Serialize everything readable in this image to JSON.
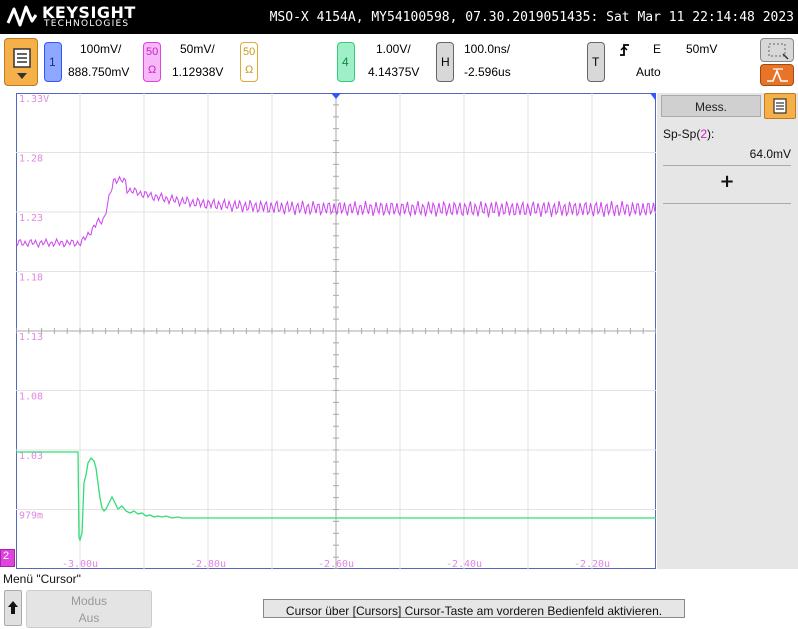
{
  "header": {
    "brand": "KEYSIGHT",
    "brand_sub": "TECHNOLOGIES",
    "instrument": "MSO-X 4154A, MY54100598, 07.30.2019051435: Sat Mar 11 22:14:48 2023"
  },
  "toolbar": {
    "ch1": {
      "num": "1",
      "scale": "100mV/",
      "offset": "888.750mV"
    },
    "ch2": {
      "imp_top": "50",
      "imp_bot": "Ω",
      "scale": "50mV/",
      "offset": "1.12938V"
    },
    "ch3": {
      "imp_top": "50",
      "imp_bot": "Ω"
    },
    "ch4": {
      "num": "4",
      "scale": "1.00V/",
      "offset": "4.14375V"
    },
    "horiz": {
      "label": "H",
      "scale": "100.0ns/",
      "offset": "-2.596us"
    },
    "trigger": {
      "label": "T",
      "edge": "E",
      "level": "50mV",
      "mode": "Auto"
    },
    "colors": {
      "ch1": "#3355ff",
      "ch2": "#dd44dd",
      "ch3": "#ddaa33",
      "ch4": "#33cc77",
      "accent_orange": "#e8742a"
    }
  },
  "screen": {
    "y_labels": [
      "1.33V",
      "1.28",
      "1.23",
      "1.18",
      "1.13",
      "1.08",
      "1.03",
      "979m"
    ],
    "x_labels": [
      "-3.00u",
      "-2.80u",
      "-2.60u",
      "-2.40u",
      "-2.20u"
    ],
    "ch_marker": "2"
  },
  "panel": {
    "title": "Mess.",
    "meas_label_pre": "Sp-Sp(",
    "meas_label_ch": "2",
    "meas_label_post": "):",
    "meas_value": "64.0mV",
    "add_symbol": "+"
  },
  "footer": {
    "menu": "Menü \"Cursor\"",
    "mode_label": "Modus",
    "mode_value": "Aus",
    "hint": "Cursor über [Cursors] Cursor-Taste am vorderen Bedienfeld aktivieren."
  }
}
